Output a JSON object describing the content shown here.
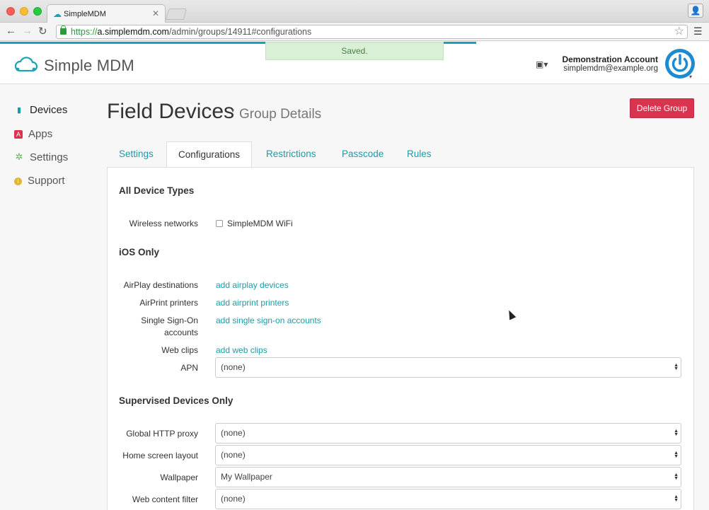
{
  "browser": {
    "tab_title": "SimpleMDM",
    "tab_close": "✕",
    "url_proto": "https://",
    "url_host": "a.simplemdm.com",
    "url_path": "/admin/groups/14911#configurations"
  },
  "header": {
    "brand": "Simple MDM",
    "saved_message": "Saved.",
    "account_name": "Demonstration Account",
    "account_email": "simplemdm@example.org"
  },
  "sidebar": {
    "items": [
      {
        "label": "Devices",
        "icon": "device-icon",
        "color": "#1a9ca8"
      },
      {
        "label": "Apps",
        "icon": "app-icon",
        "color": "#d9344f"
      },
      {
        "label": "Settings",
        "icon": "gear-icon",
        "color": "#5cb85c"
      },
      {
        "label": "Support",
        "icon": "info-icon",
        "color": "#e0b63a"
      }
    ]
  },
  "main": {
    "title": "Field Devices",
    "subtitle": "Group Details",
    "delete_label": "Delete Group",
    "tabs": [
      "Settings",
      "Configurations",
      "Restrictions",
      "Passcode",
      "Rules"
    ]
  },
  "config": {
    "section_all": "All Device Types",
    "wireless_label": "Wireless networks",
    "wireless_option": "SimpleMDM WiFi",
    "section_ios": "iOS Only",
    "airplay_label": "AirPlay destinations",
    "airplay_link": "add airplay devices",
    "airprint_label": "AirPrint printers",
    "airprint_link": "add airprint printers",
    "sso_label_1": "Single Sign-On",
    "sso_label_2": "accounts",
    "sso_link": "add single sign-on accounts",
    "webclips_label": "Web clips",
    "webclips_link": "add web clips",
    "apn_label": "APN",
    "apn_value": "(none)",
    "section_supervised": "Supervised Devices Only",
    "proxy_label": "Global HTTP proxy",
    "proxy_value": "(none)",
    "homescreen_label": "Home screen layout",
    "homescreen_value": "(none)",
    "wallpaper_label": "Wallpaper",
    "wallpaper_value": "My Wallpaper",
    "webfilter_label": "Web content filter",
    "webfilter_value": "(none)"
  },
  "colors": {
    "accent": "#1a9ca8",
    "danger": "#d9344f",
    "success_bg": "#d9f0d6"
  }
}
